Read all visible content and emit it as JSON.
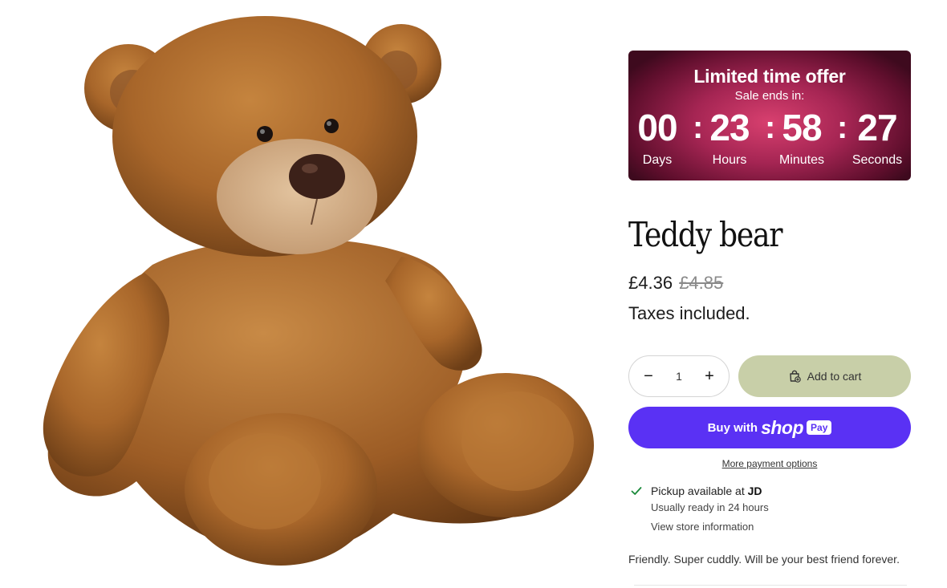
{
  "media": {
    "image_alt": "Teddy bear product image"
  },
  "timer": {
    "title": "Limited time offer",
    "subtitle": "Sale ends in:",
    "segments": [
      {
        "value": "00",
        "label": "Days"
      },
      {
        "value": "23",
        "label": "Hours"
      },
      {
        "value": "58",
        "label": "Minutes"
      },
      {
        "value": "27",
        "label": "Seconds"
      }
    ],
    "separator": ":"
  },
  "product": {
    "title": "Teddy bear",
    "price_sale": "£4.36",
    "price_compare": "£4.85",
    "taxes_note": "Taxes included.",
    "description": "Friendly. Super cuddly. Will be your best friend forever."
  },
  "quantity": {
    "minus": "−",
    "value": "1",
    "plus": "+"
  },
  "cart": {
    "label": "Add to cart",
    "icon": "bag-plus-icon"
  },
  "shop_pay": {
    "prefix": "Buy with",
    "brand": "shop",
    "pay": "Pay"
  },
  "more_payment": "More payment options",
  "pickup": {
    "text": "Pickup available at",
    "location": "JD",
    "ready": "Usually ready in 24 hours",
    "store_link": "View store information",
    "icon": "check-icon"
  },
  "colors": {
    "cart_button": "#c8cfa8",
    "shop_pay": "#5a31f4",
    "timer_accent": "#d8406f",
    "check": "#1a8a3a"
  }
}
